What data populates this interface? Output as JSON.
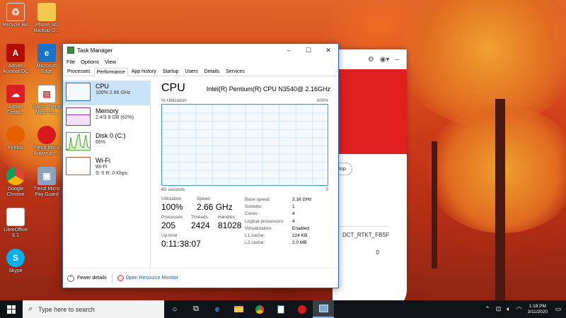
{
  "desktop_icons": [
    {
      "label": "Recycle Bin",
      "icon": "recycle-bin-icon"
    },
    {
      "label": "Phone SD Backup O...",
      "icon": "folder-icon"
    },
    {
      "label": "Adobe Acrobat DC",
      "icon": "acrobat-icon"
    },
    {
      "label": "Microsoft Edge",
      "icon": "edge-icon"
    },
    {
      "label": "Adobe Creati...",
      "icon": "creative-cloud-icon"
    },
    {
      "label": "Sam's Trend Micro co...",
      "icon": "document-icon"
    },
    {
      "label": "Firefox",
      "icon": "firefox-icon"
    },
    {
      "label": "Trend Micro Antivirus+...",
      "icon": "trend-micro-icon"
    },
    {
      "label": "Google Chrome",
      "icon": "chrome-icon"
    },
    {
      "label": "Trend Micro Pay Guard",
      "icon": "pay-guard-icon"
    },
    {
      "label": "LibreOffice 6.1",
      "icon": "libreoffice-icon"
    },
    {
      "label": "Skype",
      "icon": "skype-icon"
    }
  ],
  "bg_app": {
    "pill_text": "top",
    "code_text": "DCT_RTKT_FBSF",
    "count_text": "0"
  },
  "task_manager": {
    "title": "Task Manager",
    "window_buttons": {
      "minimize": "–",
      "maximize": "☐",
      "close": "✕"
    },
    "menu": [
      "File",
      "Options",
      "View"
    ],
    "tabs": [
      "Processes",
      "Performance",
      "App history",
      "Startup",
      "Users",
      "Details",
      "Services"
    ],
    "active_tab": "Performance",
    "resources": [
      {
        "title": "CPU",
        "sub1": "100%  2.66 GHz",
        "sub2": "",
        "color": "#1c6fbf",
        "active": true
      },
      {
        "title": "Memory",
        "sub1": "2.4/3.9 GB (62%)",
        "sub2": "",
        "color": "#8b2fa5",
        "active": false
      },
      {
        "title": "Disk 0 (C:)",
        "sub1": "66%",
        "sub2": "",
        "color": "#4aa832",
        "active": false
      },
      {
        "title": "Wi-Fi",
        "sub1": "Wi-Fi",
        "sub2": "S: 0  R: 0 Kbps",
        "color": "#b5562b",
        "active": false
      }
    ],
    "cpu": {
      "title": "CPU",
      "name": "Intel(R) Pentium(R) CPU N3540@ 2.16GHz",
      "graph_label_left": "% Utilization",
      "graph_label_right": "100%",
      "axis_left": "60 seconds",
      "axis_right": "0",
      "utilization_label": "Utilization",
      "utilization": "100%",
      "speed_label": "Speed",
      "speed": "2.66 GHz",
      "processes_label": "Processes",
      "processes": "205",
      "threads_label": "Threads",
      "threads": "2424",
      "handles_label": "Handles",
      "handles": "81028",
      "uptime_label": "Up time",
      "uptime": "0:11:38:07",
      "details": [
        {
          "k": "Base speed:",
          "v": "2.16 GHz"
        },
        {
          "k": "Sockets:",
          "v": "1"
        },
        {
          "k": "Cores:",
          "v": "4"
        },
        {
          "k": "Logical processors:",
          "v": "4"
        },
        {
          "k": "Virtualization:",
          "v": "Enabled"
        },
        {
          "k": "L1 cache:",
          "v": "224 KB"
        },
        {
          "k": "L2 cache:",
          "v": "2.0 MB"
        }
      ]
    },
    "footer": {
      "fewer_details": "Fewer details",
      "open_monitor": "Open Resource Monitor"
    }
  },
  "taskbar": {
    "search_placeholder": "Type here to search",
    "time": "1:18 PM",
    "date": "3/11/2020"
  }
}
